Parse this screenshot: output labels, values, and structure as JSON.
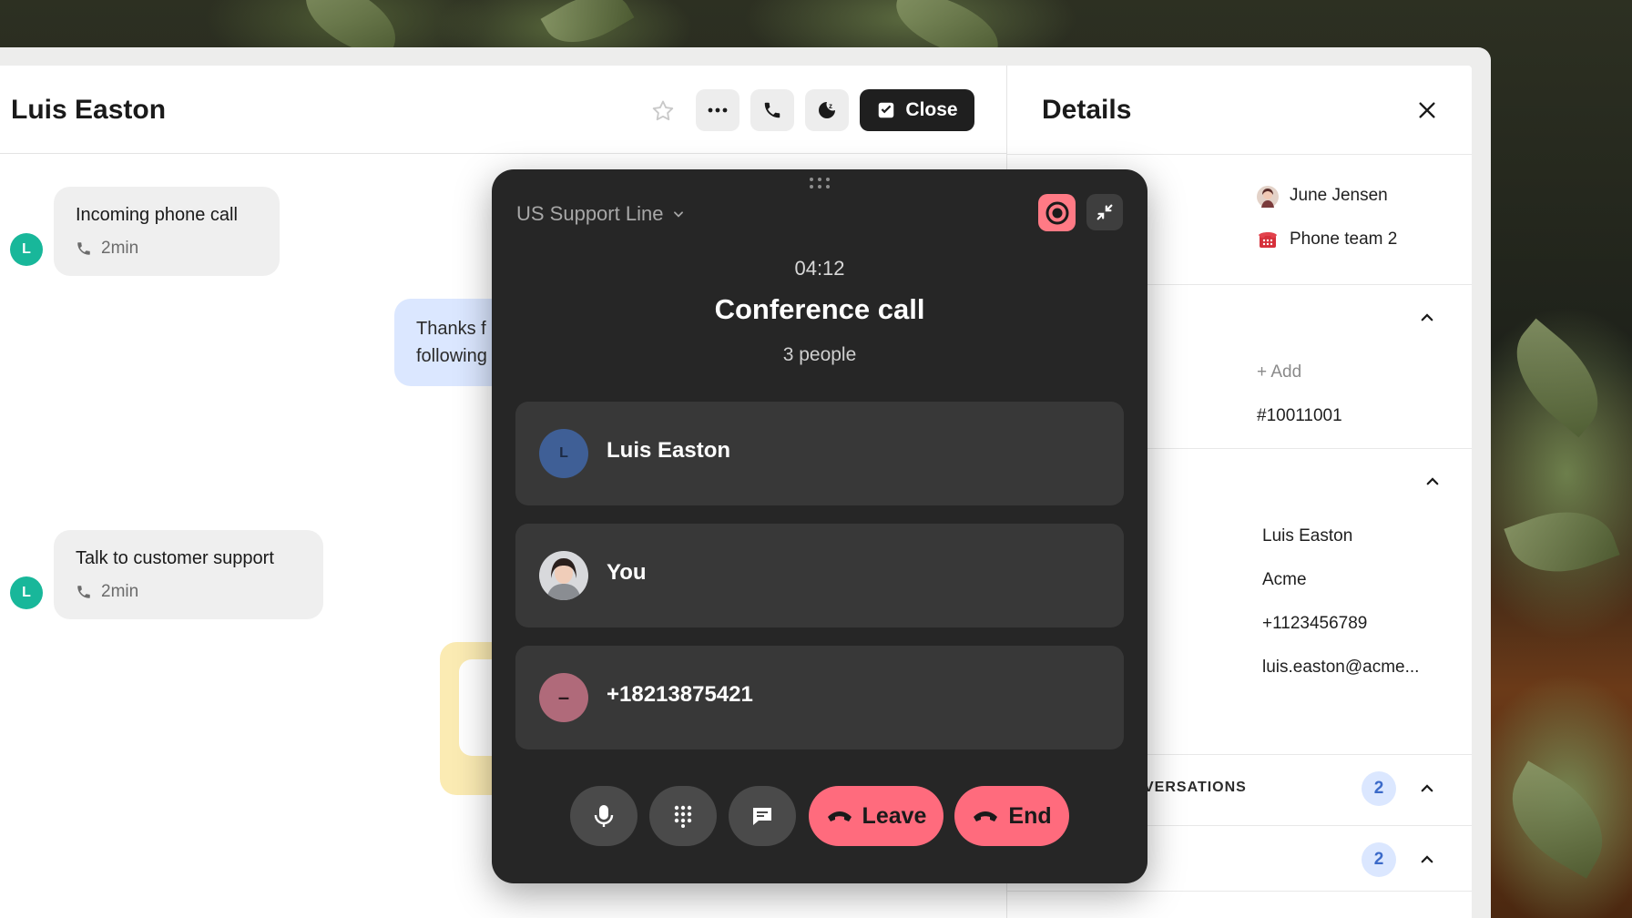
{
  "conversation": {
    "title": "Luis Easton",
    "close_label": "Close",
    "messages": [
      {
        "avatar_initial": "L",
        "text": "Incoming phone call",
        "duration": "2min"
      },
      {
        "text_line1": "Thanks f",
        "text_line2": "following"
      },
      {
        "avatar_initial": "L",
        "text": "Talk to customer support",
        "duration": "2min"
      }
    ]
  },
  "details": {
    "title": "Details",
    "assignee": "June Jensen",
    "team": "Phone team 2",
    "add_label": "+ Add",
    "ticket_id": "#10011001",
    "contact": {
      "name": "Luis Easton",
      "company": "Acme",
      "phone": "+1123456789",
      "email": "luis.easton@acme..."
    },
    "conversations_label": "VERSATIONS",
    "conversations_count": "2",
    "second_count": "2"
  },
  "call": {
    "line": "US Support Line",
    "timer": "04:12",
    "title": "Conference call",
    "people": "3 people",
    "participants": [
      {
        "initial": "L",
        "name": "Luis Easton",
        "avatar_color": "#3f5f96"
      },
      {
        "name": "You"
      },
      {
        "initial": "–",
        "name": "+18213875421",
        "avatar_color": "#b06a7a"
      }
    ],
    "leave_label": "Leave",
    "end_label": "End"
  },
  "colors": {
    "accent_red": "#ff6b7d",
    "record": "#ff7a85",
    "teal_avatar": "#18b79a",
    "badge_blue": "#dbe7ff"
  }
}
